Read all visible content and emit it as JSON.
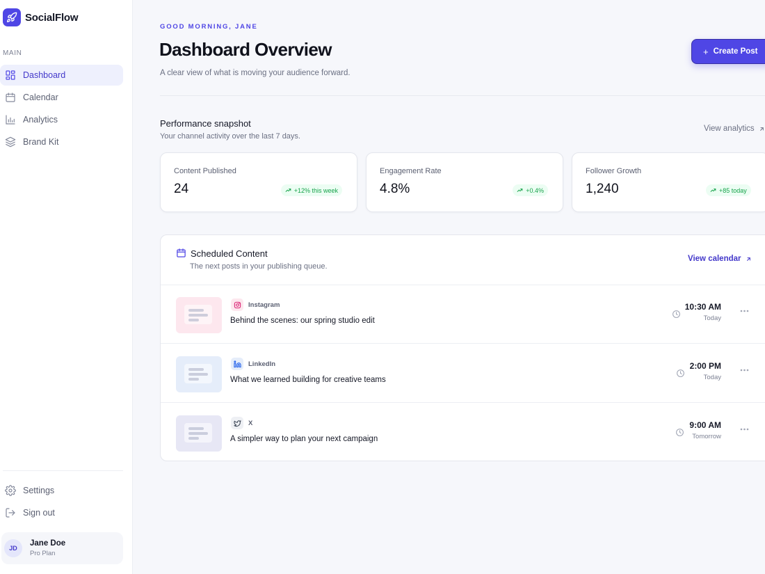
{
  "brand": {
    "name": "SocialFlow",
    "logo_icon": "rocket-icon",
    "accent": "#4f46e5"
  },
  "sidebar": {
    "section_label": "MAIN",
    "items": [
      {
        "label": "Dashboard",
        "icon": "grid-icon",
        "active": true
      },
      {
        "label": "Calendar",
        "icon": "calendar-icon",
        "active": false
      },
      {
        "label": "Analytics",
        "icon": "bar-chart-icon",
        "active": false
      },
      {
        "label": "Brand Kit",
        "icon": "layers-icon",
        "active": false
      }
    ],
    "bottom_items": [
      {
        "label": "Settings",
        "icon": "gear-icon"
      },
      {
        "label": "Sign out",
        "icon": "sign-out-icon"
      }
    ],
    "user": {
      "initials": "JD",
      "name": "Jane Doe",
      "plan": "Pro Plan"
    }
  },
  "header": {
    "greeting": "GOOD MORNING, JANE",
    "title": "Dashboard Overview",
    "subtitle": "A clear view of what is moving your audience forward.",
    "create_button": "Create Post"
  },
  "performance": {
    "title": "Performance snapshot",
    "subtitle": "Your channel activity over the last 7 days.",
    "link": "View analytics",
    "cards": [
      {
        "label": "Content Published",
        "value": "24",
        "badge": "+12% this week"
      },
      {
        "label": "Engagement Rate",
        "value": "4.8%",
        "badge": "+0.4%"
      },
      {
        "label": "Follower Growth",
        "value": "1,240",
        "badge": "+85 today"
      }
    ]
  },
  "scheduled": {
    "title": "Scheduled Content",
    "subtitle": "The next posts in your publishing queue.",
    "link": "View calendar",
    "posts": [
      {
        "platform": "Instagram",
        "platform_icon": "instagram-icon",
        "title": "Behind the scenes: our spring studio edit",
        "time": "10:30 AM",
        "day": "Today",
        "thumb_color": "#fde7ee"
      },
      {
        "platform": "LinkedIn",
        "platform_icon": "linkedin-icon",
        "title": "What we learned building for creative teams",
        "time": "2:00 PM",
        "day": "Today",
        "thumb_color": "#e5edfa"
      },
      {
        "platform": "X",
        "platform_icon": "twitter-icon",
        "title": "A simpler way to plan your next campaign",
        "time": "9:00 AM",
        "day": "Tomorrow",
        "thumb_color": "#e7e7f5"
      }
    ]
  }
}
